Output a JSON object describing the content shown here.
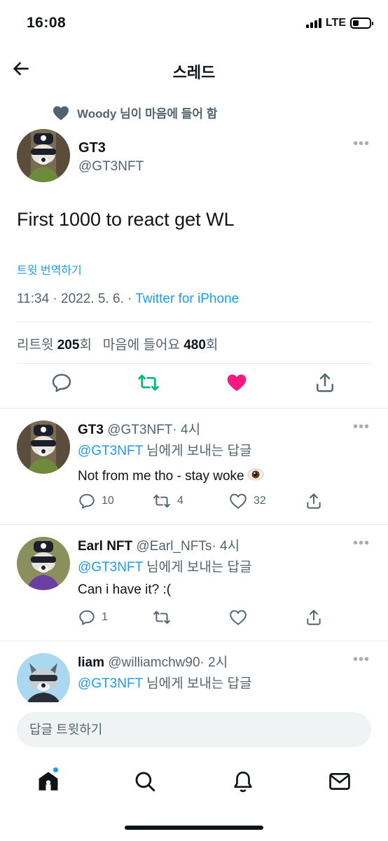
{
  "status_bar": {
    "time": "16:08",
    "network": "LTE",
    "battery_level": 0.35
  },
  "header": {
    "title": "스레드"
  },
  "liked_by": {
    "text": "Woody 님이 마음에 들어 함"
  },
  "main_tweet": {
    "name": "GT3",
    "handle": "@GT3NFT",
    "text": "First 1000 to react get WL",
    "translate": "트윗 번역하기",
    "time_date": "11:34 · 2022. 5. 6. · ",
    "source": "Twitter for iPhone",
    "retweets_label": "리트윗",
    "retweets_count": "205",
    "retweets_unit": "회",
    "likes_label": "마음에 들어요",
    "likes_count": "480",
    "likes_unit": "회",
    "liked": true
  },
  "replies": [
    {
      "name": "GT3",
      "handle": "@GT3NFT",
      "time": "· 4시",
      "reply_to": "@GT3NFT",
      "reply_suffix": " 님에게 보내는 답글",
      "text": "Not from me tho - stay woke",
      "replies": "10",
      "retweets": "4",
      "likes": "32"
    },
    {
      "name": "Earl NFT",
      "handle": "@Earl_NFTs",
      "time": "· 4시",
      "reply_to": "@GT3NFT",
      "reply_suffix": " 님에게 보내는 답글",
      "text": "Can i have it? :(",
      "replies": "1",
      "retweets": "",
      "likes": ""
    },
    {
      "name": "liam",
      "handle": "@williamchw90",
      "time": "· 2시",
      "reply_to": "@GT3NFT",
      "reply_suffix": " 님에게 보내는 답글",
      "text": "",
      "replies": "",
      "retweets": "",
      "likes": ""
    }
  ],
  "compose": {
    "placeholder": "답글 트윗하기"
  },
  "colors": {
    "accent": "#1d9bf0",
    "like": "#f91880",
    "retweet": "#00ba7c",
    "secondary": "#536471"
  },
  "icons": {
    "back": "arrow-left-icon",
    "reply": "speech-bubble-icon",
    "retweet": "retweet-icon",
    "like": "heart-icon",
    "share": "share-icon",
    "tabs": [
      "home-icon",
      "search-icon",
      "bell-icon",
      "mail-icon"
    ]
  }
}
